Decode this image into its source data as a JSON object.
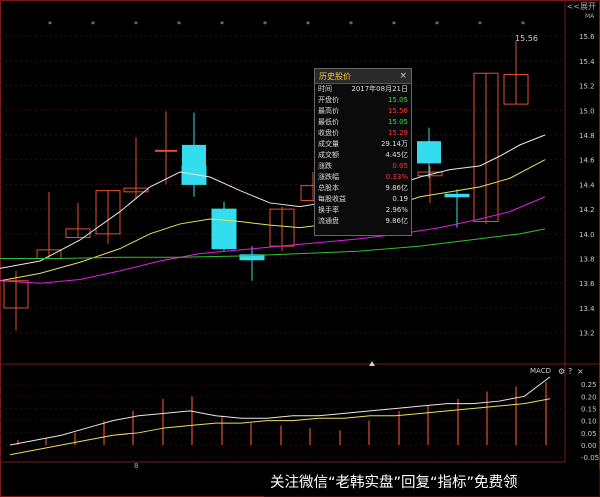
{
  "header": {
    "expand_label": "<<展开",
    "top_right_label": "MA"
  },
  "price_tip": "15.56",
  "price_axis": {
    "ticks": [
      "15.6",
      "15.4",
      "15.2",
      "15.0",
      "14.8",
      "14.6",
      "14.4",
      "14.2",
      "14.0",
      "13.8",
      "13.6",
      "13.4",
      "13.2"
    ]
  },
  "macd_axis": {
    "ticks": [
      "0.25",
      "0.20",
      "0.15",
      "0.10",
      "0.05",
      "0.00",
      "-0.05"
    ]
  },
  "x_axis": {
    "label": "8"
  },
  "popup": {
    "title": "历史股价",
    "close": "×",
    "rows": [
      {
        "label": "时间",
        "value": "2017年08月21日",
        "color": "#dddddd"
      },
      {
        "label": "开盘价",
        "value": "15.05",
        "color": "#33dd33"
      },
      {
        "label": "最高价",
        "value": "15.56",
        "color": "#ff3333"
      },
      {
        "label": "最低价",
        "value": "15.05",
        "color": "#33dd33"
      },
      {
        "label": "收盘价",
        "value": "15.29",
        "color": "#ff3333"
      },
      {
        "label": "成交量",
        "value": "29.14万",
        "color": "#dddddd"
      },
      {
        "label": "成交额",
        "value": "4.45亿",
        "color": "#dddddd"
      },
      {
        "label": "涨跌",
        "value": "0.05",
        "color": "#ff3333"
      },
      {
        "label": "涨跌幅",
        "value": "0.33%",
        "color": "#ff3333"
      },
      {
        "label": "总股本",
        "value": "9.86亿",
        "color": "#dddddd"
      },
      {
        "label": "每股收益",
        "value": "0.19",
        "color": "#dddddd"
      },
      {
        "label": "换手率",
        "value": "2.96%",
        "color": "#dddddd"
      },
      {
        "label": "流通盘",
        "value": "9.86亿",
        "color": "#dddddd"
      }
    ]
  },
  "macd": {
    "label": "MACD",
    "gear": "⚙",
    "help": "?",
    "close": "×"
  },
  "watermark": "关注微信“老韩实盘”回复“指标”免费领",
  "colors": {
    "up": "#e05030",
    "down": "#33ddee",
    "ma5": "#e8e8e8",
    "ma10": "#e8e060",
    "ma20": "#e020e0",
    "ma60": "#30c030",
    "dif": "#e8e8e8",
    "dea": "#e8e060"
  },
  "chart_data": {
    "type": "candlestick",
    "price_range": [
      13.1,
      15.65
    ],
    "candles": [
      {
        "open": 13.4,
        "close": 13.62,
        "high": 13.7,
        "low": 13.22
      },
      {
        "open": 13.8,
        "close": 13.87,
        "high": 14.34,
        "low": 13.8
      },
      {
        "open": 13.97,
        "close": 14.04,
        "high": 14.25,
        "low": 13.97
      },
      {
        "open": 14.0,
        "close": 14.35,
        "high": 14.35,
        "low": 13.92
      },
      {
        "open": 14.34,
        "close": 14.37,
        "high": 14.78,
        "low": 14.28
      },
      {
        "open": 14.55,
        "close": 14.4,
        "high": 14.98,
        "low": 14.3
      },
      {
        "open": 14.2,
        "close": 13.88,
        "high": 14.26,
        "low": 13.86
      },
      {
        "open": 13.83,
        "close": 13.79,
        "high": 13.9,
        "low": 13.62
      },
      {
        "open": 13.9,
        "close": 14.2,
        "high": 14.22,
        "low": 13.86
      },
      {
        "open": 14.27,
        "close": 14.39,
        "high": 14.5,
        "low": 14.26
      },
      {
        "open": 14.72,
        "close": 14.53,
        "high": 14.82,
        "low": 14.48
      },
      {
        "open": 14.47,
        "close": 14.5,
        "high": 14.55,
        "low": 14.25
      },
      {
        "open": 14.32,
        "close": 14.3,
        "high": 14.36,
        "low": 14.05
      },
      {
        "open": 14.1,
        "close": 15.3,
        "high": 15.3,
        "low": 14.08
      },
      {
        "open": 15.05,
        "close": 15.29,
        "high": 15.56,
        "low": 15.05
      }
    ],
    "macd_range": [
      -0.07,
      0.3
    ],
    "macd_bars": [
      0.02,
      0.03,
      0.05,
      0.1,
      0.14,
      0.19,
      0.2,
      0.12,
      0.09,
      0.08,
      0.07,
      0.06,
      0.1,
      0.14,
      0.16,
      0.19,
      0.22,
      0.24,
      0.26,
      0.28,
      0.27,
      0.23
    ],
    "dif": [
      0.0,
      0.02,
      0.04,
      0.07,
      0.1,
      0.12,
      0.13,
      0.14,
      0.12,
      0.11,
      0.11,
      0.12,
      0.12,
      0.13,
      0.14,
      0.15,
      0.16,
      0.17,
      0.17,
      0.18,
      0.2,
      0.28
    ],
    "dea": [
      -0.04,
      -0.02,
      0.0,
      0.02,
      0.04,
      0.05,
      0.07,
      0.08,
      0.09,
      0.09,
      0.1,
      0.1,
      0.11,
      0.11,
      0.12,
      0.12,
      0.13,
      0.14,
      0.15,
      0.16,
      0.17,
      0.19
    ]
  }
}
